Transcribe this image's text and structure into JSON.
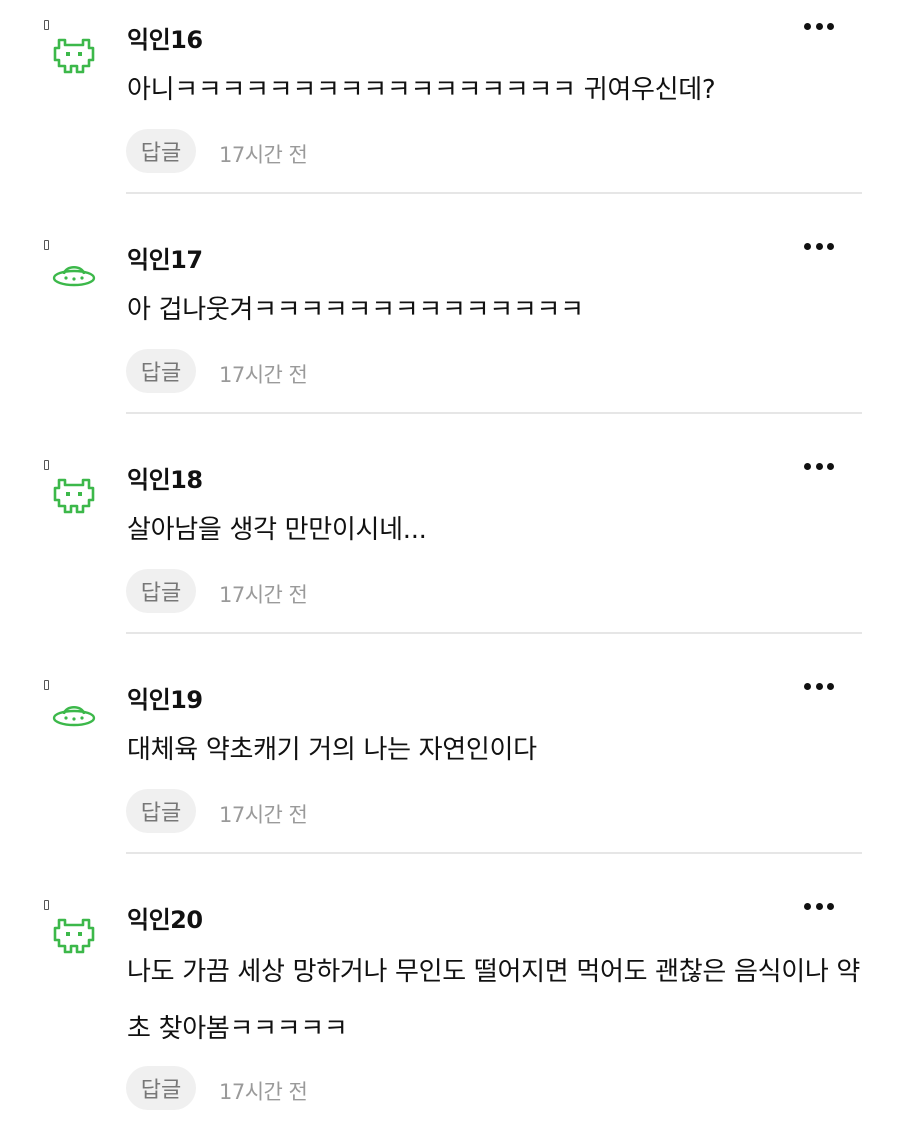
{
  "comments": [
    {
      "author": "익인16",
      "avatar": "green-space-invader-icon",
      "text": "아니ㅋㅋㅋㅋㅋㅋㅋㅋㅋㅋㅋㅋㅋㅋㅋㅋㅋ 귀여우신데?",
      "reply_label": "답글",
      "time": "17시간 전"
    },
    {
      "author": "익인17",
      "avatar": "green-ufo-icon",
      "text": "아 겁나웃겨ㅋㅋㅋㅋㅋㅋㅋㅋㅋㅋㅋㅋㅋㅋ",
      "reply_label": "답글",
      "time": "17시간 전"
    },
    {
      "author": "익인18",
      "avatar": "green-space-invader-icon",
      "text": "살아남을 생각 만만이시네...",
      "reply_label": "답글",
      "time": "17시간 전"
    },
    {
      "author": "익인19",
      "avatar": "green-ufo-icon",
      "text": "대체육 약초캐기 거의 나는 자연인이다",
      "reply_label": "답글",
      "time": "17시간 전"
    },
    {
      "author": "익인20",
      "avatar": "green-space-invader-icon",
      "text": "나도 가끔 세상 망하거나 무인도 떨어지면 먹어도 괜찮은 음식이나 약초 찾아봄ㅋㅋㅋㅋㅋ",
      "reply_label": "답글",
      "time": "17시간 전"
    }
  ],
  "colors": {
    "avatar_green": "#3cb84a",
    "reply_bg": "#f0f0f0",
    "divider": "#e6e6e6",
    "time_text": "#9a9a9a"
  }
}
